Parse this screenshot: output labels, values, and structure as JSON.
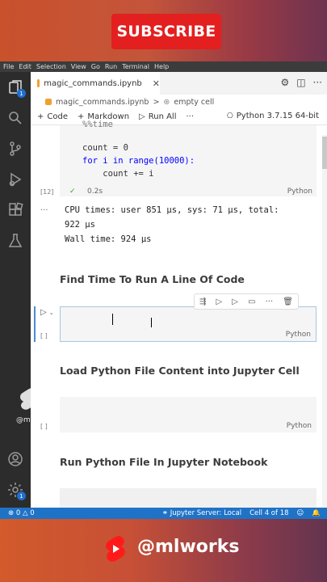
{
  "brand": {
    "subscribe_label": "SUBSCRIBE",
    "handle": "@mlworks"
  },
  "menu": [
    "File",
    "Edit",
    "Selection",
    "View",
    "Go",
    "Run",
    "Terminal",
    "Help"
  ],
  "activity": {
    "explorer_badge": "1",
    "settings_badge": "1"
  },
  "tab": {
    "filename": "magic_commands.ipynb"
  },
  "breadcrumb": {
    "file": "magic_commands.ipynb",
    "sep": ">",
    "cell": "empty cell"
  },
  "toolbar": {
    "code": "Code",
    "markdown": "Markdown",
    "run_all": "Run All",
    "more": "···",
    "kernel": "Python 3.7.15 64-bit"
  },
  "cell1": {
    "lines": [
      "%%time",
      "",
      "count = 0",
      "for i in range(10000):",
      "    count += i"
    ],
    "exec_count": "[12]",
    "duration": "0.2s",
    "language": "Python"
  },
  "output": {
    "dots": "...",
    "line1": "CPU times: user 851 µs, sys: 71 µs, total:",
    "line2": "922 µs",
    "line3": "Wall time: 924 µs"
  },
  "headings": {
    "h1": "Find Time To Run A Line Of Code",
    "h2": "Load Python File Content into Jupyter Cell",
    "h3": "Run Python File In Jupyter Notebook"
  },
  "cell2": {
    "exec_count": "[ ]",
    "language": "Python"
  },
  "cell3": {
    "exec_count": "[ ]",
    "language": "Python"
  },
  "watermark": {
    "text": "@mlworks"
  },
  "status": {
    "errors": "0",
    "warnings": "0",
    "server": "Jupyter Server: Local",
    "cell_position": "Cell 4 of 18"
  }
}
